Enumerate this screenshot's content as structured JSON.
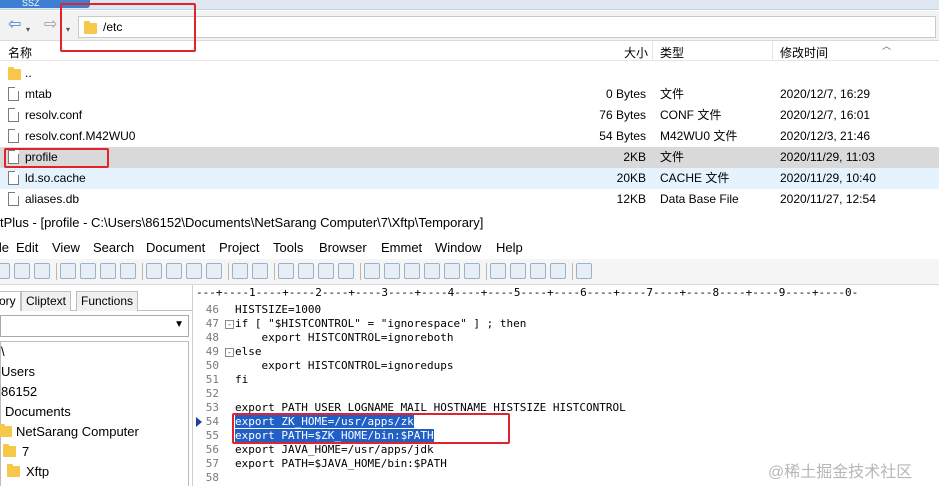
{
  "xftp": {
    "tab_label": "SSZ",
    "address": "/etc",
    "columns": {
      "name": "名称",
      "size": "大小",
      "type": "类型",
      "modified": "修改时间"
    },
    "rows": [
      {
        "name": "..",
        "size": "",
        "type": "",
        "modified": "",
        "icon": "folder-icon"
      },
      {
        "name": "mtab",
        "size": "0 Bytes",
        "type": "文件",
        "modified": "2020/12/7, 16:29",
        "icon": "file-icon"
      },
      {
        "name": "resolv.conf",
        "size": "76 Bytes",
        "type": "CONF 文件",
        "modified": "2020/12/7, 16:01",
        "icon": "file-icon"
      },
      {
        "name": "resolv.conf.M42WU0",
        "size": "54 Bytes",
        "type": "M42WU0 文件",
        "modified": "2020/12/3, 21:46",
        "icon": "file-icon"
      },
      {
        "name": "profile",
        "size": "2KB",
        "type": "文件",
        "modified": "2020/11/29, 11:03",
        "icon": "file-icon",
        "state": "selected"
      },
      {
        "name": "ld.so.cache",
        "size": "20KB",
        "type": "CACHE 文件",
        "modified": "2020/11/29, 10:40",
        "icon": "file-icon",
        "state": "hover"
      },
      {
        "name": "aliases.db",
        "size": "12KB",
        "type": "Data Base File",
        "modified": "2020/11/27, 12:54",
        "icon": "file-icon"
      }
    ]
  },
  "editplus": {
    "title": "tPlus - [profile - C:\\Users\\86152\\Documents\\NetSarang Computer\\7\\Xftp\\Temporary]",
    "menu": [
      "File",
      "Edit",
      "View",
      "Search",
      "Document",
      "Project",
      "Tools",
      "Browser",
      "Emmet",
      "Window",
      "Help"
    ],
    "sidebar_tabs": [
      "ory",
      "Cliptext",
      "Functions"
    ],
    "tree": [
      "\\",
      "Users",
      "86152",
      "Documents",
      "NetSarang Computer",
      "7",
      "Xftp"
    ],
    "ruler": "---+----1----+----2----+----3----+----4----+----5----+----6----+----7----+----8----+----9----+----0-",
    "lines": [
      {
        "num": "46",
        "text": "HISTSIZE=1000"
      },
      {
        "num": "47",
        "text": "if [ \"$HISTCONTROL\" = \"ignorespace\" ] ; then",
        "fold": "⊟"
      },
      {
        "num": "48",
        "text": "    export HISTCONTROL=ignoreboth"
      },
      {
        "num": "49",
        "text": "else",
        "fold": "⊟"
      },
      {
        "num": "50",
        "text": "    export HISTCONTROL=ignoredups"
      },
      {
        "num": "51",
        "text": "fi"
      },
      {
        "num": "52",
        "text": ""
      },
      {
        "num": "53",
        "text": "export PATH USER LOGNAME MAIL HOSTNAME HISTSIZE HISTCONTROL"
      },
      {
        "num": "54",
        "text": "export ZK_HOME=/usr/apps/zk",
        "selected": true
      },
      {
        "num": "55",
        "text": "export PATH=$ZK_HOME/bin:$PATH",
        "selected": true
      },
      {
        "num": "56",
        "text": "export JAVA_HOME=/usr/apps/jdk"
      },
      {
        "num": "57",
        "text": "export PATH=$JAVA_HOME/bin:$PATH"
      },
      {
        "num": "58",
        "text": ""
      }
    ]
  },
  "watermark": "@稀土掘金技术社区",
  "colors": {
    "highlight_box": "#e3232b",
    "selection": "#1f5fc6",
    "selected_row": "#d9d9d9",
    "hover_row": "#e5f3ff"
  }
}
